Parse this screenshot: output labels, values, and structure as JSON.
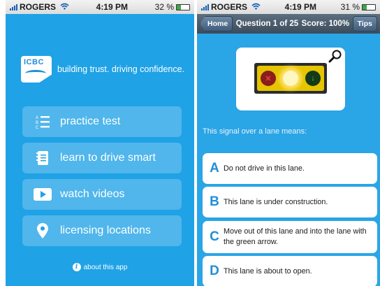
{
  "left": {
    "status": {
      "carrier": "ROGERS",
      "time": "4:19 PM",
      "battery": "32 %",
      "battery_level": 0.32
    },
    "logo": {
      "text": "ICBC",
      "tagline": "building trust. driving confidence."
    },
    "menu": [
      {
        "label": "practice test",
        "icon": "list-abc-icon"
      },
      {
        "label": "learn to drive smart",
        "icon": "book-icon"
      },
      {
        "label": "watch videos",
        "icon": "play-icon"
      },
      {
        "label": "licensing locations",
        "icon": "location-pin-icon"
      }
    ],
    "about": {
      "label": "about this app",
      "icon": "info-icon"
    }
  },
  "right": {
    "status": {
      "carrier": "ROGERS",
      "time": "4:19 PM",
      "battery": "31 %",
      "battery_level": 0.31
    },
    "nav": {
      "home": "Home",
      "title": "Question 1 of 25",
      "score": "Score: 100%",
      "tips": "Tips"
    },
    "question": "This signal over a lane means:",
    "answers": [
      {
        "letter": "A",
        "text": "Do not drive in this lane."
      },
      {
        "letter": "B",
        "text": "This lane is under construction."
      },
      {
        "letter": "C",
        "text": "Move out of this lane and into the lane with the green arrow."
      },
      {
        "letter": "D",
        "text": "This lane is about to open."
      }
    ]
  },
  "colors": {
    "background": "#1fa2e6",
    "accent": "#1f8fd6",
    "navbar": "#4a5d6e"
  }
}
